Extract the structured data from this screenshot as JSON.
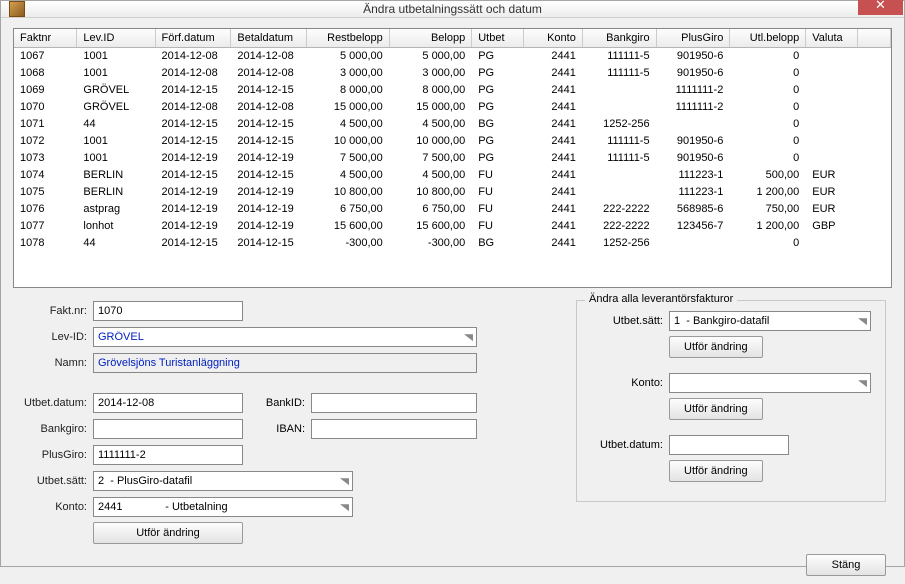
{
  "window": {
    "title": "Ändra utbetalningssätt och datum",
    "close_glyph": "✕"
  },
  "table": {
    "headers": [
      "Faktnr",
      "Lev.ID",
      "Förf.datum",
      "Betaldatum",
      "Restbelopp",
      "Belopp",
      "Utbet",
      "Konto",
      "Bankgiro",
      "PlusGiro",
      "Utl.belopp",
      "Valuta"
    ],
    "align": [
      "l",
      "l",
      "l",
      "l",
      "r",
      "r",
      "l",
      "r",
      "r",
      "r",
      "r",
      "l"
    ],
    "rows": [
      [
        "1067",
        "1001",
        "2014-12-08",
        "2014-12-08",
        "5 000,00",
        "5 000,00",
        "PG",
        "2441",
        "111111-5",
        "901950-6",
        "0",
        ""
      ],
      [
        "1068",
        "1001",
        "2014-12-08",
        "2014-12-08",
        "3 000,00",
        "3 000,00",
        "PG",
        "2441",
        "111111-5",
        "901950-6",
        "0",
        ""
      ],
      [
        "1069",
        "GRÖVEL",
        "2014-12-15",
        "2014-12-15",
        "8 000,00",
        "8 000,00",
        "PG",
        "2441",
        "",
        "1111111-2",
        "0",
        ""
      ],
      [
        "1070",
        "GRÖVEL",
        "2014-12-08",
        "2014-12-08",
        "15 000,00",
        "15 000,00",
        "PG",
        "2441",
        "",
        "1111111-2",
        "0",
        ""
      ],
      [
        "1071",
        "44",
        "2014-12-15",
        "2014-12-15",
        "4 500,00",
        "4 500,00",
        "BG",
        "2441",
        "1252-256",
        "",
        "0",
        ""
      ],
      [
        "1072",
        "1001",
        "2014-12-15",
        "2014-12-15",
        "10 000,00",
        "10 000,00",
        "PG",
        "2441",
        "111111-5",
        "901950-6",
        "0",
        ""
      ],
      [
        "1073",
        "1001",
        "2014-12-19",
        "2014-12-19",
        "7 500,00",
        "7 500,00",
        "PG",
        "2441",
        "111111-5",
        "901950-6",
        "0",
        ""
      ],
      [
        "1074",
        "BERLIN",
        "2014-12-15",
        "2014-12-15",
        "4 500,00",
        "4 500,00",
        "FU",
        "2441",
        "",
        "111223-1",
        "500,00",
        "EUR"
      ],
      [
        "1075",
        "BERLIN",
        "2014-12-19",
        "2014-12-19",
        "10 800,00",
        "10 800,00",
        "FU",
        "2441",
        "",
        "111223-1",
        "1 200,00",
        "EUR"
      ],
      [
        "1076",
        "astprag",
        "2014-12-19",
        "2014-12-19",
        "6 750,00",
        "6 750,00",
        "FU",
        "2441",
        "222-2222",
        "568985-6",
        "750,00",
        "EUR"
      ],
      [
        "1077",
        "lonhot",
        "2014-12-19",
        "2014-12-19",
        "15 600,00",
        "15 600,00",
        "FU",
        "2441",
        "222-2222",
        "123456-7",
        "1 200,00",
        "GBP"
      ],
      [
        "1078",
        "44",
        "2014-12-15",
        "2014-12-15",
        "-300,00",
        "-300,00",
        "BG",
        "2441",
        "1252-256",
        "",
        "0",
        ""
      ]
    ]
  },
  "form": {
    "faktnr_label": "Fakt.nr:",
    "faktnr": "1070",
    "levid_label": "Lev-ID:",
    "levid": "GRÖVEL",
    "namn_label": "Namn:",
    "namn": "Grövelsjöns Turistanläggning",
    "utbetdatum_label": "Utbet.datum:",
    "utbetdatum": "2014-12-08",
    "bankid_label": "BankID:",
    "bankid": "",
    "bankgiro_label": "Bankgiro:",
    "bankgiro": "",
    "iban_label": "IBAN:",
    "iban": "",
    "plusgiro_label": "PlusGiro:",
    "plusgiro": "1111111-2",
    "utbetsatt_label": "Utbet.sätt:",
    "utbetsatt": "2  - PlusGiro-datafil",
    "konto_label": "Konto:",
    "konto": "2441              - Utbetalning",
    "action_label": "Utför ändring"
  },
  "group": {
    "legend": "Ändra alla leverantörsfakturor",
    "utbetsatt_label": "Utbet.sätt:",
    "utbetsatt": "1  - Bankgiro-datafil",
    "action_label": "Utför ändring",
    "konto_label": "Konto:",
    "konto": "",
    "utbetdatum_label": "Utbet.datum:",
    "utbetdatum": ""
  },
  "buttons": {
    "close": "Stäng"
  }
}
